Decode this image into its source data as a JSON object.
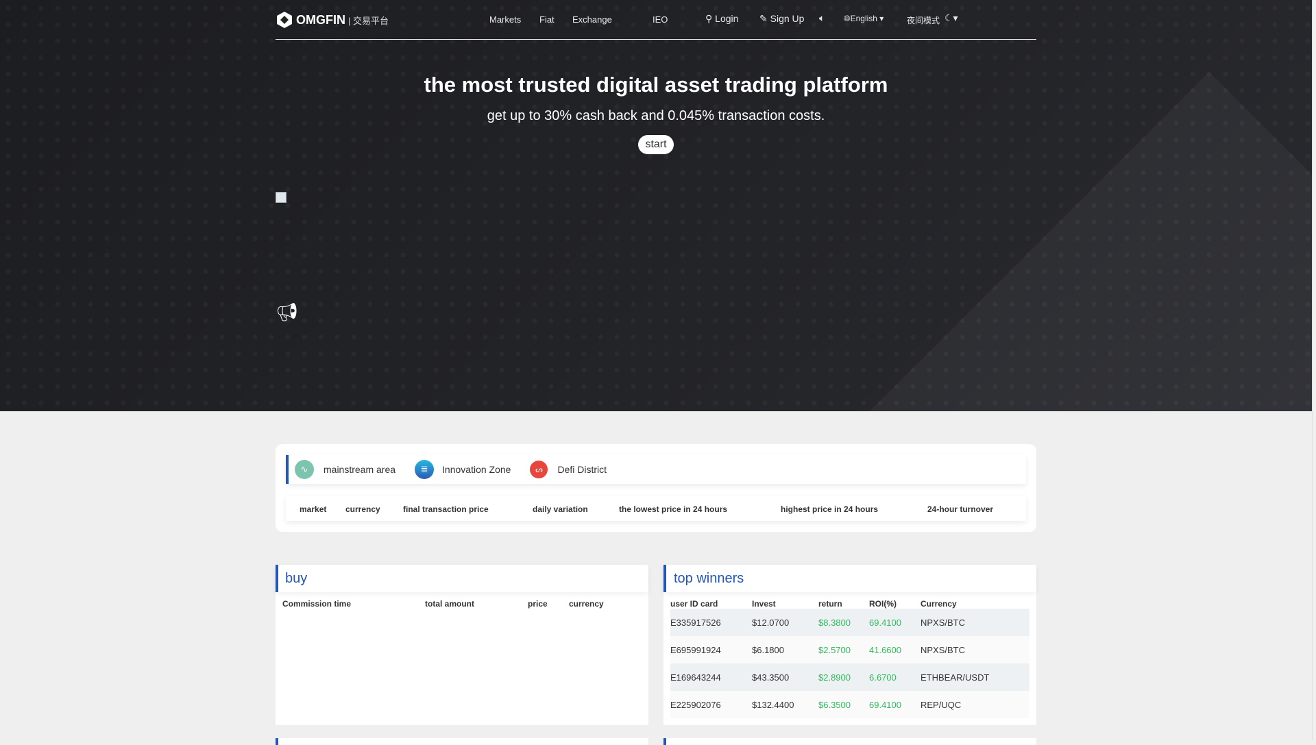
{
  "header": {
    "logo": "OMGFIN",
    "logo_sub": "| 交易平台",
    "nav": [
      "Markets",
      "Fiat",
      "Exchange",
      "IEO"
    ],
    "login": "Login",
    "signup": "Sign Up",
    "language": "English",
    "night_mode": "夜间模式"
  },
  "hero": {
    "title": "the most trusted digital asset trading platform",
    "subtitle": "get up to 30% cash back and 0.045% transaction costs.",
    "start": "start"
  },
  "markets": {
    "tabs": [
      "mainstream area",
      "Innovation Zone",
      "Defi District"
    ],
    "columns": [
      "market",
      "currency",
      "final transaction price",
      "daily variation",
      "the lowest price in 24 hours",
      "highest price in 24 hours",
      "24-hour turnover"
    ]
  },
  "buy": {
    "title": "buy",
    "columns": [
      "Commission time",
      "total amount",
      "price",
      "currency"
    ]
  },
  "winners": {
    "title": "top winners",
    "columns": [
      "user ID card",
      "Invest",
      "return",
      "ROI(%)",
      "Currency"
    ],
    "rows": [
      [
        "E335917526",
        "$12.0700",
        "$8.3800",
        "69.4100",
        "NPXS/BTC"
      ],
      [
        "E695991924",
        "$6.1800",
        "$2.5700",
        "41.6600",
        "NPXS/BTC"
      ],
      [
        "E169643244",
        "$43.3500",
        "$2.8900",
        "6.6700",
        "ETHBEAR/USDT"
      ],
      [
        "E225902076",
        "$132.4400",
        "$6.3500",
        "69.4100",
        "REP/UQC"
      ]
    ]
  },
  "colors": {
    "accent": "#2356b5",
    "positive": "#2ebd5b"
  }
}
